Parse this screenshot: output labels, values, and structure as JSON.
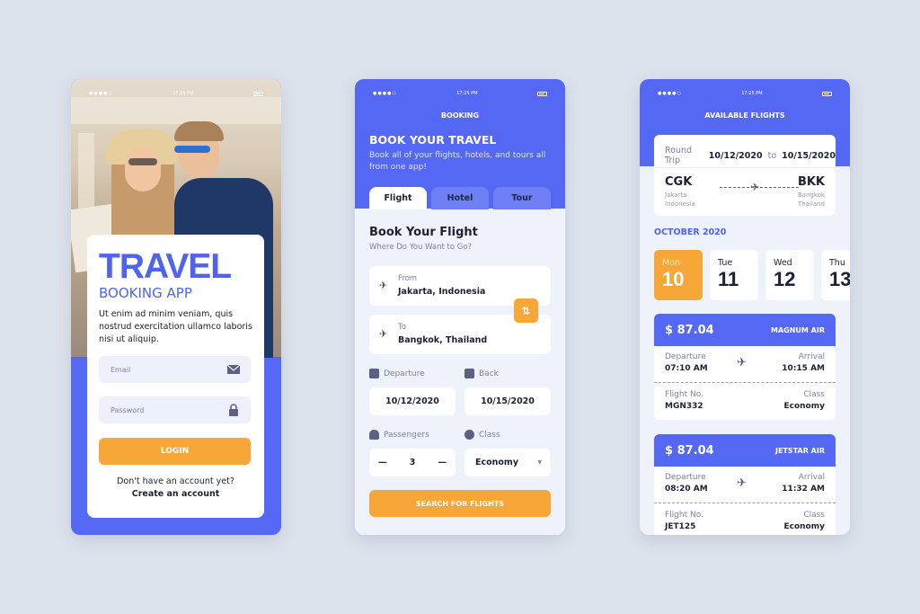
{
  "status_bar": {
    "time": "17:25 PM"
  },
  "login_screen": {
    "title": "TRAVEL",
    "subtitle": "BOOKING APP",
    "description": "Ut enim ad minim veniam, quis nostrud exercitation ullamco laboris nisi ut aliquip.",
    "email_placeholder": "Email",
    "password_placeholder": "Password",
    "login_label": "LOGIN",
    "no_account_text": "Don't have an account yet?",
    "create_account_label": "Create an account",
    "icons": {
      "email": "envelope-icon",
      "password": "lock-icon"
    }
  },
  "booking_screen": {
    "header_title": "BOOKING",
    "headline": "BOOK YOUR TRAVEL",
    "description": "Book all of your flights, hotels, and tours all from one app!",
    "tabs": [
      {
        "label": "Flight",
        "active": true
      },
      {
        "label": "Hotel",
        "active": false
      },
      {
        "label": "Tour",
        "active": false
      }
    ],
    "section_title": "Book Your Flight",
    "section_subtitle": "Where Do You Want to Go?",
    "from_label": "From",
    "from_value": "Jakarta, Indonesia",
    "to_label": "To",
    "to_value": "Bangkok, Thailand",
    "departure_label": "Departure",
    "departure_value": "10/12/2020",
    "back_label": "Back",
    "back_value": "10/15/2020",
    "passengers_label": "Passengers",
    "passengers_value": "3",
    "class_label": "Class",
    "class_value": "Economy",
    "search_label": "SEARCH FOR FLIGHTS"
  },
  "flights_screen": {
    "header_title": "AVAILABLE FLIGHTS",
    "trip_type": "Round Trip",
    "date_from": "10/12/2020",
    "date_sep": "to",
    "date_to": "10/15/2020",
    "origin": {
      "code": "CGK",
      "city": "Jakarta",
      "country": "Indonesia"
    },
    "destination": {
      "code": "BKK",
      "city": "Bangkok",
      "country": "Thailand"
    },
    "month": "OCTOBER 2020",
    "days": [
      {
        "name": "Mon",
        "num": "10",
        "active": true
      },
      {
        "name": "Tue",
        "num": "11",
        "active": false
      },
      {
        "name": "Wed",
        "num": "12",
        "active": false
      },
      {
        "name": "Thu",
        "num": "13",
        "active": false
      }
    ],
    "labels": {
      "departure": "Departure",
      "arrival": "Arrival",
      "flight_no": "Flight No.",
      "class": "Class"
    },
    "flights": [
      {
        "price": "$ 87.04",
        "airline": "MAGNUM AIR",
        "departure": "07:10 AM",
        "arrival": "10:15 AM",
        "flight_no": "MGN332",
        "class": "Economy"
      },
      {
        "price": "$ 87.04",
        "airline": "JETSTAR AIR",
        "departure": "08:20 AM",
        "arrival": "11:32 AM",
        "flight_no": "JET125",
        "class": "Economy"
      }
    ]
  },
  "colors": {
    "primary": "#5468f3",
    "accent": "#f6a737",
    "background": "#dde3ec"
  }
}
